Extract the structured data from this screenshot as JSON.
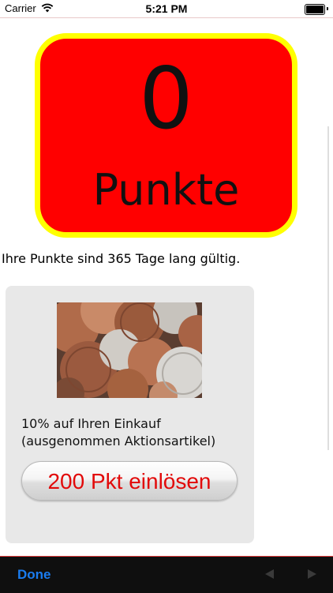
{
  "status_bar": {
    "carrier": "Carrier",
    "time": "5:21 PM",
    "icons": [
      "wifi-icon",
      "battery-icon"
    ]
  },
  "points": {
    "value": "0",
    "unit": "Punkte",
    "colors": {
      "background": "#ff0000",
      "border": "#ffff00"
    }
  },
  "validity_text": "Ihre Punkte sind 365 Tage lang gültig.",
  "offer": {
    "image": "coins-photo",
    "description_line1": "10% auf Ihren Einkauf",
    "description_line2": "(ausgenommen Aktionsartikel)",
    "redeem_label": "200 Pkt einlösen",
    "redeem_color": "#e20a0a"
  },
  "toolbar": {
    "done_label": "Done",
    "prev_icon": "triangle-left-icon",
    "next_icon": "triangle-right-icon"
  }
}
